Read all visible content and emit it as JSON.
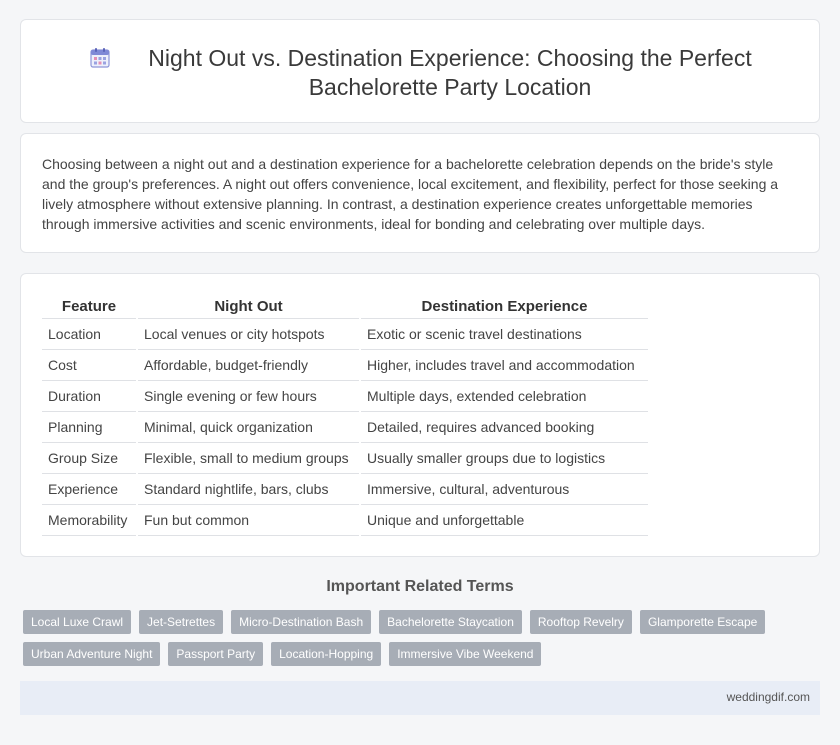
{
  "header": {
    "title": "Night Out vs. Destination Experience: Choosing the Perfect Bachelorette Party Location",
    "icon": "calendar-icon"
  },
  "intro": {
    "text": "Choosing between a night out and a destination experience for a bachelorette celebration depends on the bride's style and the group's preferences. A night out offers convenience, local excitement, and flexibility, perfect for those seeking a lively atmosphere without extensive planning. In contrast, a destination experience creates unforgettable memories through immersive activities and scenic environments, ideal for bonding and celebrating over multiple days."
  },
  "table": {
    "headers": [
      "Feature",
      "Night Out",
      "Destination Experience"
    ],
    "rows": [
      [
        "Location",
        "Local venues or city hotspots",
        "Exotic or scenic travel destinations"
      ],
      [
        "Cost",
        "Affordable, budget-friendly",
        "Higher, includes travel and accommodation"
      ],
      [
        "Duration",
        "Single evening or few hours",
        "Multiple days, extended celebration"
      ],
      [
        "Planning",
        "Minimal, quick organization",
        "Detailed, requires advanced booking"
      ],
      [
        "Group Size",
        "Flexible, small to medium groups",
        "Usually smaller groups due to logistics"
      ],
      [
        "Experience",
        "Standard nightlife, bars, clubs",
        "Immersive, cultural, adventurous"
      ],
      [
        "Memorability",
        "Fun but common",
        "Unique and unforgettable"
      ]
    ]
  },
  "related": {
    "heading": "Important Related Terms",
    "tags_row1": [
      "Local Luxe Crawl",
      "Jet-Setrettes",
      "Micro-Destination Bash",
      "Bachelorette Staycation",
      "Rooftop Revelry",
      "Glamporette Escape"
    ],
    "tags_row2": [
      "Urban Adventure Night",
      "Passport Party",
      "Location-Hopping",
      "Immersive Vibe Weekend"
    ]
  },
  "footer": {
    "site": "weddingdif.com"
  },
  "colors": {
    "tag_bg": "#a7adb6",
    "footer_bg": "#e8edf6",
    "page_bg": "#f5f6f8"
  }
}
